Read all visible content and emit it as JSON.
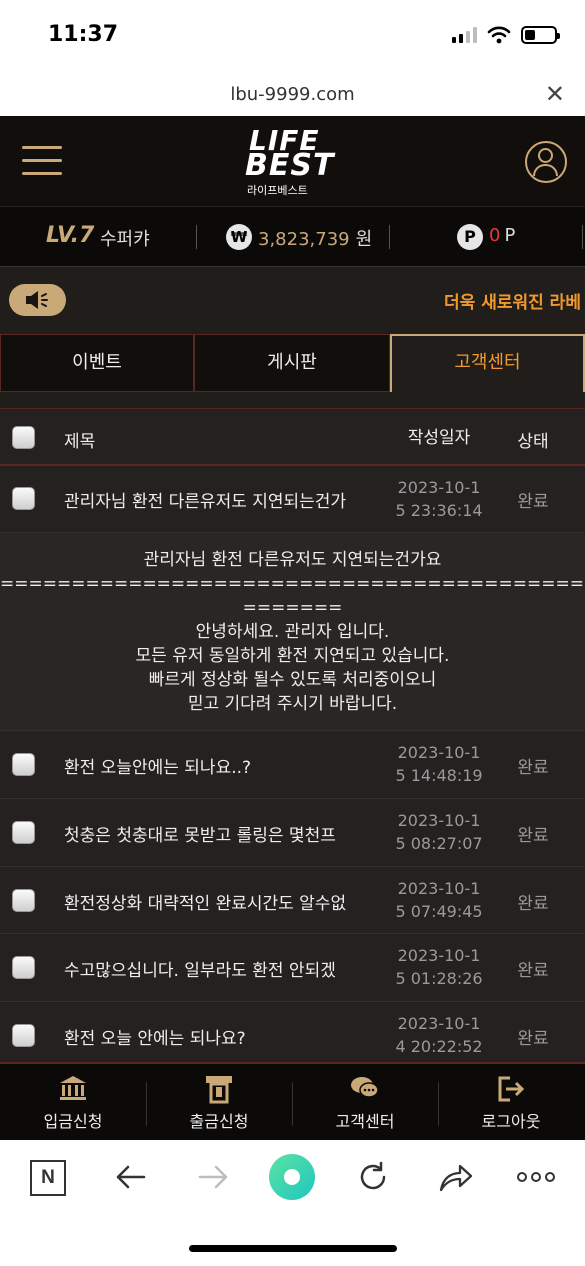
{
  "statusbar": {
    "time": "11:37"
  },
  "browser": {
    "url": "lbu-9999.com"
  },
  "header": {
    "logo_line1": "LIFE",
    "logo_line2": "BEST",
    "logo_sub": "라이프베스트"
  },
  "user": {
    "level": "LV.7",
    "nickname": "수퍼캬",
    "balance": "3,823,739",
    "balance_unit": "원",
    "won_symbol": "₩",
    "points": "0",
    "points_unit": "P",
    "points_symbol": "P"
  },
  "notice": {
    "text": "더욱 새로워진 라베"
  },
  "tabs": [
    {
      "label": "이벤트"
    },
    {
      "label": "게시판"
    },
    {
      "label": "고객센터"
    }
  ],
  "table": {
    "headers": {
      "title": "제목",
      "date": "작성일자",
      "status": "상태"
    },
    "rows": [
      {
        "title": "관리자님 환전 다른유저도 지연되는건가",
        "date_line1": "2023-10-1",
        "date_line2": "5 23:36:14",
        "status": "완료"
      },
      {
        "title": "환전 오늘안에는 되나요..?",
        "date_line1": "2023-10-1",
        "date_line2": "5 14:48:19",
        "status": "완료"
      },
      {
        "title": "첫충은 첫충대로 못받고 롤링은 몇천프",
        "date_line1": "2023-10-1",
        "date_line2": "5 08:27:07",
        "status": "완료"
      },
      {
        "title": "환전정상화 대략적인 완료시간도 알수없",
        "date_line1": "2023-10-1",
        "date_line2": "5 07:49:45",
        "status": "완료"
      },
      {
        "title": "수고많으십니다. 일부라도 환전 안되겠",
        "date_line1": "2023-10-1",
        "date_line2": "5 01:28:26",
        "status": "완료"
      },
      {
        "title": "환전 오늘 안에는 되나요?",
        "date_line1": "2023-10-1",
        "date_line2": "4 20:22:52",
        "status": "완료"
      }
    ],
    "expanded": {
      "question": "관리자님 환전 다른유저도 지연되는건가요",
      "separator": "====================================================================",
      "separator_tail": "=======",
      "answer_lines": [
        "안녕하세요. 관리자 입니다.",
        "모든 유저 동일하게 환전 지연되고 있습니다.",
        "빠르게 정상화 될수 있도록 처리중이오니",
        "믿고 기다려 주시기 바랍니다."
      ]
    }
  },
  "bottom_nav": [
    {
      "label": "입금신청",
      "icon": "bank-icon"
    },
    {
      "label": "출금신청",
      "icon": "atm-icon"
    },
    {
      "label": "고객센터",
      "icon": "chat-icon"
    },
    {
      "label": "로그아웃",
      "icon": "logout-icon"
    }
  ],
  "browser_toolbar": {
    "n_label": "N"
  },
  "colors": {
    "gold": "#c9a978",
    "orange": "#f09a2e",
    "red": "#e53935",
    "bg_dark": "#120e0c"
  }
}
